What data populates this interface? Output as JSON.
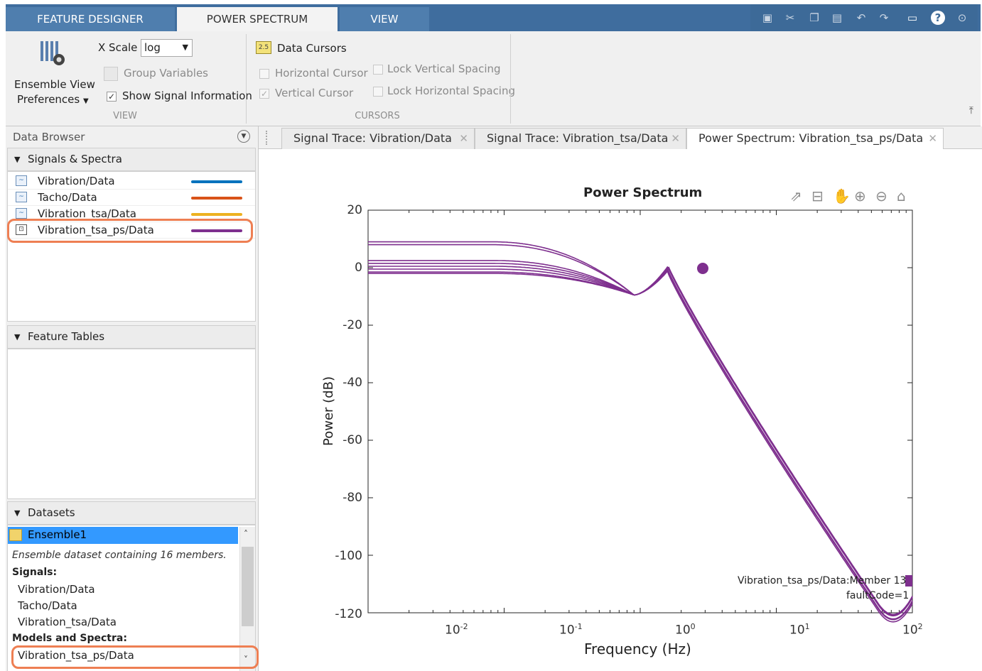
{
  "top_tabs": [
    {
      "label": "FEATURE DESIGNER"
    },
    {
      "label": "POWER SPECTRUM"
    },
    {
      "label": "VIEW"
    }
  ],
  "ribbon": {
    "ensemble_view_prefs": "Ensemble View\nPreferences",
    "ensemble_view_line1": "Ensemble View",
    "ensemble_view_line2": "Preferences",
    "xscale_label": "X Scale",
    "xscale_value": "log",
    "group_variables": "Group Variables",
    "show_signal_info": "Show Signal Information",
    "view_section": "VIEW",
    "data_cursors": "Data Cursors",
    "horizontal_cursor": "Horizontal Cursor",
    "vertical_cursor": "Vertical Cursor",
    "lock_vertical_spacing": "Lock Vertical Spacing",
    "lock_horizontal_spacing": "Lock Horizontal Spacing",
    "cursors_section": "CURSORS"
  },
  "data_browser": {
    "title": "Data Browser",
    "signals_header": "Signals & Spectra",
    "signals": [
      {
        "label": "Vibration/Data",
        "color": "#0072bd"
      },
      {
        "label": "Tacho/Data",
        "color": "#d95319"
      },
      {
        "label": "Vibration_tsa/Data",
        "color": "#edb120"
      },
      {
        "label": "Vibration_tsa_ps/Data",
        "color": "#7e2f8e"
      }
    ],
    "feature_tables_header": "Feature Tables",
    "datasets_header": "Datasets",
    "dataset_name": "Ensemble1",
    "dataset_desc": "Ensemble dataset containing 16 members.",
    "signals_label": "Signals:",
    "dataset_signals": [
      "Vibration/Data",
      "Tacho/Data",
      "Vibration_tsa/Data"
    ],
    "models_label": "Models and Spectra:",
    "model_item": "Vibration_tsa_ps/Data"
  },
  "doc_tabs": [
    {
      "label": "Signal Trace: Vibration/Data"
    },
    {
      "label": "Signal Trace: Vibration_tsa/Data"
    },
    {
      "label": "Power Spectrum: Vibration_tsa_ps/Data"
    }
  ],
  "chart_data": {
    "type": "line",
    "title": "Power Spectrum",
    "xlabel": "Frequency  (Hz)",
    "ylabel": "Power (dB)",
    "x_scale": "log",
    "xlim": [
      0.01,
      100
    ],
    "ylim": [
      -120,
      20
    ],
    "yticks": [
      "20",
      "0",
      "-20",
      "-40",
      "-60",
      "-80",
      "-100",
      "-120"
    ],
    "xticks": [
      "10",
      "10",
      "10",
      "10",
      "10"
    ],
    "xtick_exponents": [
      "-2",
      "-1",
      "0",
      "1",
      "2"
    ],
    "line_color": "#7e2f8e",
    "resonance_hz": 1.6,
    "series": [
      {
        "low_db": 9,
        "peak_db": 0
      },
      {
        "low_db": 8,
        "peak_db": -1
      },
      {
        "low_db": 2.5,
        "peak_db": 0
      },
      {
        "low_db": 1.5,
        "peak_db": -1
      },
      {
        "low_db": 0.5,
        "peak_db": 0.5
      },
      {
        "low_db": -0.5,
        "peak_db": -0.5
      },
      {
        "low_db": -1.5,
        "peak_db": 0
      },
      {
        "low_db": -2,
        "peak_db": -1
      }
    ],
    "annotation_line1": "Vibration_tsa_ps/Data:Member 13",
    "annotation_line2": "faultCode=1"
  }
}
